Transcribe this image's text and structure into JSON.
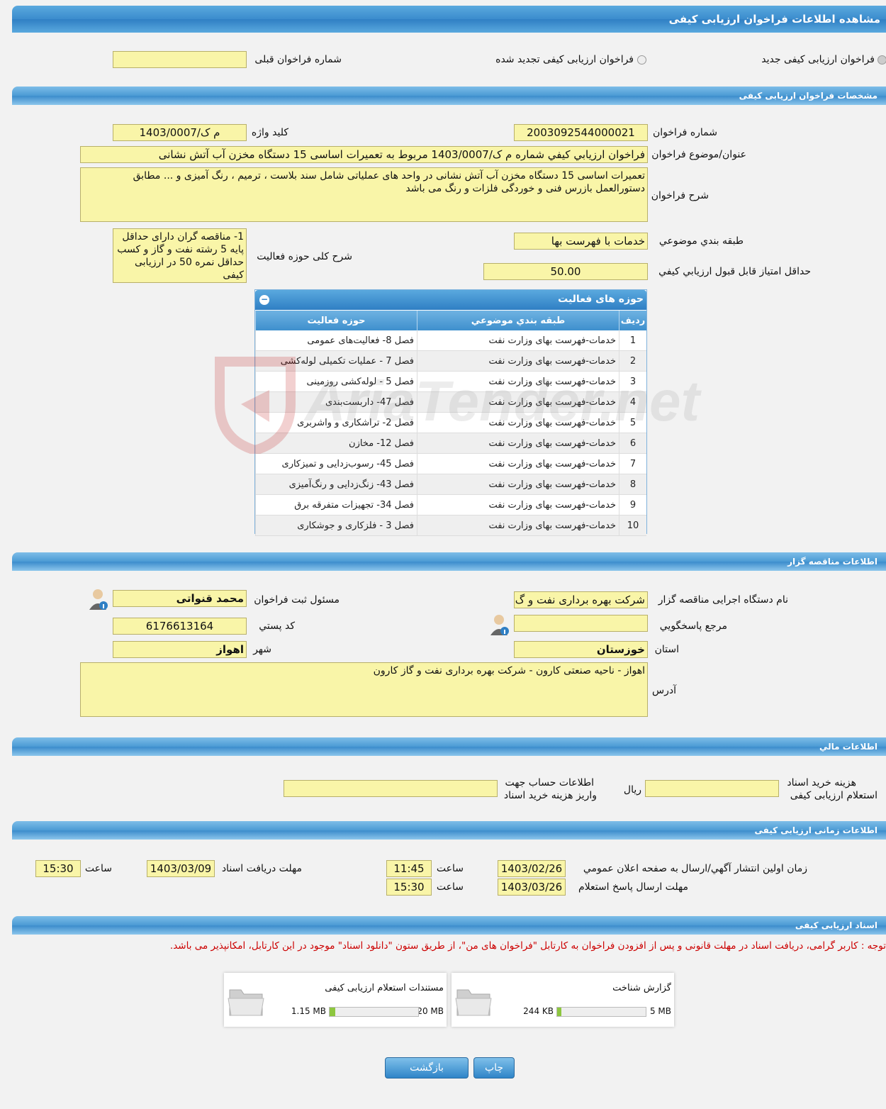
{
  "page_title": "مشاهده اطلاعات فراخوان ارزیابی کیفی",
  "top_options": {
    "new_label": "فراخوان ارزیابی کیفی جدید",
    "renewed_label": "فراخوان ارزیابی کیفی تجدید شده",
    "previous_number_label": "شماره فراخوان قبلی",
    "previous_number_value": ""
  },
  "spec": {
    "section_title": "مشخصات فراخوان ارزیابی کیفی",
    "number_label": "شماره فراخوان",
    "number_value": "2003092544000021",
    "keyword_label": "کلید واژه",
    "keyword_value": "م ک/1403/0007",
    "subject_label": "عنوان/موضوع فراخوان",
    "subject_value": "فراخوان ارزيابي كيفي شماره م ک/1403/0007 مربوط به تعميرات اساسی 15 دستگاه مخزن آب آتش نشانی",
    "desc_label": "شرح فراخوان",
    "desc_value": "تعمیرات اساسی 15 دستگاه مخزن آب آتش نشانی در واحد های عملیاتی شامل سند بلاست ، ترمیم ، رنگ آمیزی و ... مطابق دستورالعمل بازرس فنی و خوردگی فلزات و رنگ می باشد",
    "category_label": "طبقه بندي موضوعي",
    "category_value": "خدمات با فهرست بها",
    "scope_label": "شرح کلی حوزه فعالیت",
    "scope_value": "1- مناقصه گران دارای حداقل پایه 5 رشته نفت و گاز و کسب حداقل نمره 50 در ارزیابی کیفی",
    "min_score_label": "حداقل امتياز قابل قبول ارزيابي كيفي",
    "min_score_value": "50.00"
  },
  "activity": {
    "panel_title": "حوزه های فعالیت",
    "col_row": "رديف",
    "col_category": "طبقه بندي موضوعي",
    "col_field": "حوزه فعالیت",
    "rows": [
      {
        "n": "1",
        "cat": "خدمات-فهرست بهای وزارت نفت",
        "field": "فصل 8- فعالیت‌های عمومی"
      },
      {
        "n": "2",
        "cat": "خدمات-فهرست بهای وزارت نفت",
        "field": "فصل 7 - عملیات تکمیلی لوله‌کشی"
      },
      {
        "n": "3",
        "cat": "خدمات-فهرست بهای وزارت نفت",
        "field": "فصل 5 - لوله‌کشی روزمینی"
      },
      {
        "n": "4",
        "cat": "خدمات-فهرست بهای وزارت نفت",
        "field": "فصل 47- داربست‌بندی"
      },
      {
        "n": "5",
        "cat": "خدمات-فهرست بهای وزارت نفت",
        "field": "فصل 2- تراشکاری و واشربری"
      },
      {
        "n": "6",
        "cat": "خدمات-فهرست بهای وزارت نفت",
        "field": "فصل 12- مخازن"
      },
      {
        "n": "7",
        "cat": "خدمات-فهرست بهای وزارت نفت",
        "field": "فصل 45- رسوب‌زدایی و تمیزکاری"
      },
      {
        "n": "8",
        "cat": "خدمات-فهرست بهای وزارت نفت",
        "field": "فصل 43- زنگ‌زدایی و رنگ‌آمیزی"
      },
      {
        "n": "9",
        "cat": "خدمات-فهرست بهای وزارت نفت",
        "field": "فصل 34- تجهیزات متفرقه برق"
      },
      {
        "n": "10",
        "cat": "خدمات-فهرست بهای وزارت نفت",
        "field": "فصل 3 - فلزکاری و جوشکاری"
      }
    ]
  },
  "tenderer": {
    "section_title": "اطلاعات مناقصه گزار",
    "org_label": "نام دستگاه اجرایی مناقصه گزار",
    "org_value": "شرکت بهره برداری نفت و گ",
    "registrar_label": "مسئول ثبت فراخوان",
    "registrar_value": "محمد قنواتی",
    "ref_label": "مرجع پاسخگويي",
    "ref_value": "",
    "postal_label": "کد پستي",
    "postal_value": "6176613164",
    "province_label": "استان",
    "province_value": "خوزستان",
    "city_label": "شهر",
    "city_value": "اهواز",
    "address_label": "آدرس",
    "address_value": "اهواز - ناحیه صنعتی کارون - شرکت بهره برداری نفت و گاز کارون"
  },
  "financial": {
    "section_title": "اطلاعات مالي",
    "fee_label_1": "هزینه خرید اسناد",
    "fee_label_2": "استعلام ارزیابی کیفی",
    "fee_value": "",
    "currency": "ريال",
    "account_label_1": "اطلاعات حساب جهت",
    "account_label_2": "واريز هزينه خريد اسناد",
    "account_value": ""
  },
  "timing": {
    "section_title": "اطلاعات زمانی ارزیابی کیفی",
    "publish_label": "زمان اولين انتشار آگهي/ارسال به صفحه اعلان عمومي",
    "publish_date": "1403/02/26",
    "hour_label": "ساعت",
    "publish_time": "11:45",
    "doc_deadline_label": "مهلت دريافت اسناد",
    "doc_deadline_date": "1403/03/09",
    "doc_deadline_time": "15:30",
    "reply_deadline_label": "مهلت ارسال پاسخ استعلام",
    "reply_deadline_date": "1403/03/26",
    "reply_deadline_time": "15:30"
  },
  "documents": {
    "section_title": "اسناد ارزیابی کیفی",
    "notice": "توجه : کاربر گرامی، دریافت اسناد در مهلت قانونی و پس از افزودن فراخوان به کارتابل \"فراخوان های من\"، از طریق ستون \"دانلود اسناد\" موجود در این کارتابل، امکانپذیر می باشد.",
    "files": [
      {
        "name": "گزارش شناخت",
        "size": "244 KB",
        "max": "5 MB",
        "fill": 0.05
      },
      {
        "name": "مستندات استعلام ارزیابی کیفی",
        "size": "1.15 MB",
        "max": "20 MB",
        "fill": 0.06
      }
    ]
  },
  "buttons": {
    "print": "چاپ",
    "back": "بازگشت"
  },
  "watermark_text": "AriaTender.net",
  "colors": {
    "field_bg": "#f9f5a8",
    "header_blue": "#3b8ccd",
    "notice_red": "#cc0000"
  }
}
